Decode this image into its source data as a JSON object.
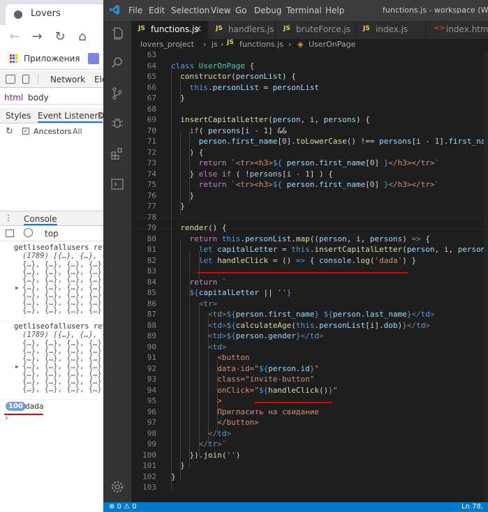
{
  "browser": {
    "tab_title": "Lovers",
    "bookmarks_label": "Приложения",
    "devtools_tabs": [
      "Network",
      "Ele"
    ],
    "breadcrumb": [
      "html",
      "body"
    ],
    "subtabs": [
      "Styles",
      "Event Listeners",
      "D"
    ],
    "ancestors_label": "Ancestors",
    "all_label": "All",
    "console_label": "Console",
    "context": "top",
    "console_log_1": {
      "title": "getliseofallusers ret",
      "summary": "(1789) [{…}, {…}, {…",
      "rows": [
        "{…}, {…}, {…}, {…}, {",
        "{…}, {…}, {…}, {…}, {",
        "{…}, {…}, {…}, {…}, {",
        "{…}, {…}, {…}, {…}, {",
        "{…}, {…}, {…}, {…}, {",
        "{…}, {…}, {…}, {…}, {",
        "{…}, {…}, {…}, {…}, {"
      ]
    },
    "console_log_2": {
      "title": "getliseofallusers ret",
      "summary": "(1789) [{…}, {…}, {…",
      "rows": [
        "{…}, {…}, {…}, {…}, {",
        "{…}, {…}, {…}, {…}, {",
        "{…}, {…}, {…}, {…}, {",
        "{…}, {…}, {…}, {…}, {",
        "{…}, {…}, {…}, {…}, {",
        "{…}, {…}, {…}, {…}, {",
        "{…}, {…}, {…}, {…}, {"
      ]
    },
    "repeat_count": "100",
    "log_message": "dada",
    "prompt": "›"
  },
  "vscode": {
    "menu": [
      "File",
      "Edit",
      "Selection",
      "View",
      "Go",
      "Debug",
      "Terminal",
      "Help"
    ],
    "window_title": "functions.js - workspace (Workspac",
    "tabs": [
      {
        "label": "functions.js",
        "kind": "JS"
      },
      {
        "label": "handlers.js",
        "kind": "JS"
      },
      {
        "label": "bruteForce.js",
        "kind": "JS"
      },
      {
        "label": "index.js",
        "kind": "JS"
      },
      {
        "label": "index.html",
        "kind": "<>"
      }
    ],
    "close_glyph": "×",
    "breadcrumb": [
      "lovers_project",
      "js",
      "functions.js",
      "UserOnPage"
    ],
    "breadcrumb_sep": "›",
    "status_left": "⊗ 0 ⚠ 0",
    "status_right": "Ln 78, C",
    "lines": [
      {
        "n": "63",
        "t": [
          [
            "",
            ""
          ]
        ]
      },
      {
        "n": "64",
        "t": [
          [
            "k",
            "class "
          ],
          [
            "c",
            "UserOnPage"
          ],
          [
            "pl",
            " {"
          ]
        ]
      },
      {
        "n": "65",
        "t": [
          [
            "pl",
            "  "
          ],
          [
            "f",
            "constructor"
          ],
          [
            "pl",
            "("
          ],
          [
            "v",
            "personList"
          ],
          [
            "pl",
            ") {"
          ]
        ]
      },
      {
        "n": "66",
        "t": [
          [
            "pl",
            "    "
          ],
          [
            "k",
            "this"
          ],
          [
            "pl",
            "."
          ],
          [
            "v",
            "personList"
          ],
          [
            "pl",
            " = "
          ],
          [
            "v",
            "personList"
          ]
        ]
      },
      {
        "n": "67",
        "t": [
          [
            "pl",
            "  }"
          ]
        ]
      },
      {
        "n": "68",
        "t": [
          [
            "",
            ""
          ]
        ]
      },
      {
        "n": "69",
        "t": [
          [
            "pl",
            "  "
          ],
          [
            "f",
            "insertCapitalLetter"
          ],
          [
            "pl",
            "("
          ],
          [
            "v",
            "person"
          ],
          [
            "pl",
            ", "
          ],
          [
            "v",
            "i"
          ],
          [
            "pl",
            ", "
          ],
          [
            "v",
            "persons"
          ],
          [
            "pl",
            ") {"
          ]
        ]
      },
      {
        "n": "70",
        "t": [
          [
            "pl",
            "    "
          ],
          [
            "kc",
            "if"
          ],
          [
            "pl",
            "( "
          ],
          [
            "v",
            "persons"
          ],
          [
            "pl",
            "["
          ],
          [
            "v",
            "i"
          ],
          [
            "pl",
            " - "
          ],
          [
            "n",
            "1"
          ],
          [
            "pl",
            "] &&"
          ]
        ]
      },
      {
        "n": "71",
        "t": [
          [
            "pl",
            "      "
          ],
          [
            "v",
            "person"
          ],
          [
            "pl",
            "."
          ],
          [
            "v",
            "first_name"
          ],
          [
            "pl",
            "["
          ],
          [
            "n",
            "0"
          ],
          [
            "pl",
            "]."
          ],
          [
            "f",
            "toLowerCase"
          ],
          [
            "pl",
            "() !== "
          ],
          [
            "v",
            "persons"
          ],
          [
            "pl",
            "["
          ],
          [
            "v",
            "i"
          ],
          [
            "pl",
            " - "
          ],
          [
            "n",
            "1"
          ],
          [
            "pl",
            "]."
          ],
          [
            "v",
            "first_name"
          ],
          [
            "pl",
            "["
          ]
        ]
      },
      {
        "n": "72",
        "t": [
          [
            "pl",
            "    ) {"
          ]
        ]
      },
      {
        "n": "73",
        "t": [
          [
            "pl",
            "      "
          ],
          [
            "kc",
            "return"
          ],
          [
            "pl",
            " "
          ],
          [
            "s",
            "`<tr><h3>"
          ],
          [
            "k",
            "${"
          ],
          [
            "pl",
            " "
          ],
          [
            "v",
            "person"
          ],
          [
            "pl",
            "."
          ],
          [
            "v",
            "first_name"
          ],
          [
            "pl",
            "["
          ],
          [
            "n",
            "0"
          ],
          [
            "pl",
            "] "
          ],
          [
            "k",
            "}"
          ],
          [
            "s",
            "</h3></tr>`"
          ]
        ]
      },
      {
        "n": "74",
        "t": [
          [
            "pl",
            "    } "
          ],
          [
            "kc",
            "else if"
          ],
          [
            "pl",
            " ( !"
          ],
          [
            "v",
            "persons"
          ],
          [
            "pl",
            "["
          ],
          [
            "v",
            "i"
          ],
          [
            "pl",
            " - "
          ],
          [
            "n",
            "1"
          ],
          [
            "pl",
            "] ) {"
          ]
        ]
      },
      {
        "n": "75",
        "t": [
          [
            "pl",
            "      "
          ],
          [
            "kc",
            "return"
          ],
          [
            "pl",
            " "
          ],
          [
            "s",
            "`<tr><h3>"
          ],
          [
            "k",
            "${"
          ],
          [
            "pl",
            " "
          ],
          [
            "v",
            "person"
          ],
          [
            "pl",
            "."
          ],
          [
            "v",
            "first_name"
          ],
          [
            "pl",
            "["
          ],
          [
            "n",
            "0"
          ],
          [
            "pl",
            "] "
          ],
          [
            "k",
            "}"
          ],
          [
            "s",
            "</h3></tr>`"
          ]
        ]
      },
      {
        "n": "76",
        "t": [
          [
            "pl",
            "    }"
          ]
        ]
      },
      {
        "n": "77",
        "t": [
          [
            "pl",
            "  }"
          ]
        ]
      },
      {
        "n": "78",
        "t": [
          [
            "",
            ""
          ]
        ]
      },
      {
        "n": "79",
        "t": [
          [
            "pl",
            "  "
          ],
          [
            "f",
            "render"
          ],
          [
            "pl",
            "() {"
          ]
        ]
      },
      {
        "n": "80",
        "t": [
          [
            "pl",
            "    "
          ],
          [
            "kc",
            "return"
          ],
          [
            "pl",
            " "
          ],
          [
            "k",
            "this"
          ],
          [
            "pl",
            "."
          ],
          [
            "v",
            "personList"
          ],
          [
            "pl",
            "."
          ],
          [
            "f",
            "map"
          ],
          [
            "pl",
            "(("
          ],
          [
            "v",
            "person"
          ],
          [
            "pl",
            ", "
          ],
          [
            "v",
            "i"
          ],
          [
            "pl",
            ", "
          ],
          [
            "v",
            "persons"
          ],
          [
            "pl",
            ") "
          ],
          [
            "k",
            "=>"
          ],
          [
            "pl",
            " {"
          ]
        ]
      },
      {
        "n": "81",
        "t": [
          [
            "pl",
            "      "
          ],
          [
            "k",
            "let"
          ],
          [
            "pl",
            " "
          ],
          [
            "v",
            "capitalLetter"
          ],
          [
            "pl",
            " = "
          ],
          [
            "k",
            "this"
          ],
          [
            "pl",
            "."
          ],
          [
            "f",
            "insertCapitalLetter"
          ],
          [
            "pl",
            "("
          ],
          [
            "v",
            "person"
          ],
          [
            "pl",
            ", "
          ],
          [
            "v",
            "i"
          ],
          [
            "pl",
            ", "
          ],
          [
            "v",
            "persons"
          ],
          [
            "pl",
            ")"
          ]
        ]
      },
      {
        "n": "82",
        "t": [
          [
            "pl",
            "      "
          ],
          [
            "k",
            "let"
          ],
          [
            "pl",
            " "
          ],
          [
            "f",
            "handleClick"
          ],
          [
            "pl",
            " = () "
          ],
          [
            "k",
            "=>"
          ],
          [
            "pl",
            " { "
          ],
          [
            "v",
            "console"
          ],
          [
            "pl",
            "."
          ],
          [
            "f",
            "log"
          ],
          [
            "pl",
            "("
          ],
          [
            "s",
            "'dada'"
          ],
          [
            "pl",
            ") }"
          ]
        ]
      },
      {
        "n": "83",
        "t": [
          [
            "",
            ""
          ]
        ]
      },
      {
        "n": "84",
        "t": [
          [
            "pl",
            "    "
          ],
          [
            "kc",
            "return"
          ],
          [
            "pl",
            " "
          ],
          [
            "s",
            "`"
          ]
        ]
      },
      {
        "n": "85",
        "t": [
          [
            "pl",
            "    "
          ],
          [
            "k",
            "${"
          ],
          [
            "v",
            "capitalLetter"
          ],
          [
            "pl",
            " || "
          ],
          [
            "s",
            "''"
          ],
          [
            "k",
            "}"
          ]
        ]
      },
      {
        "n": "86",
        "t": [
          [
            "pl",
            "      "
          ],
          [
            "tg",
            "<"
          ],
          [
            "tn",
            "tr"
          ],
          [
            "tg",
            ">"
          ]
        ]
      },
      {
        "n": "87",
        "t": [
          [
            "pl",
            "        "
          ],
          [
            "tg",
            "<"
          ],
          [
            "tn",
            "td"
          ],
          [
            "tg",
            ">"
          ],
          [
            "k",
            "${"
          ],
          [
            "v",
            "person"
          ],
          [
            "pl",
            "."
          ],
          [
            "v",
            "first_name"
          ],
          [
            "k",
            "}"
          ],
          [
            "pl",
            " "
          ],
          [
            "k",
            "${"
          ],
          [
            "v",
            "person"
          ],
          [
            "pl",
            "."
          ],
          [
            "v",
            "last_name"
          ],
          [
            "k",
            "}"
          ],
          [
            "tg",
            "</"
          ],
          [
            "tn",
            "td"
          ],
          [
            "tg",
            ">"
          ]
        ]
      },
      {
        "n": "88",
        "t": [
          [
            "pl",
            "        "
          ],
          [
            "tg",
            "<"
          ],
          [
            "tn",
            "td"
          ],
          [
            "tg",
            ">"
          ],
          [
            "k",
            "${"
          ],
          [
            "f",
            "calculateAge"
          ],
          [
            "pl",
            "("
          ],
          [
            "k",
            "this"
          ],
          [
            "pl",
            "."
          ],
          [
            "v",
            "personList"
          ],
          [
            "pl",
            "["
          ],
          [
            "v",
            "i"
          ],
          [
            "pl",
            "]."
          ],
          [
            "v",
            "dob"
          ],
          [
            "pl",
            ")"
          ],
          [
            "k",
            "}"
          ],
          [
            "tg",
            "</"
          ],
          [
            "tn",
            "td"
          ],
          [
            "tg",
            ">"
          ]
        ]
      },
      {
        "n": "89",
        "t": [
          [
            "pl",
            "        "
          ],
          [
            "tg",
            "<"
          ],
          [
            "tn",
            "td"
          ],
          [
            "tg",
            ">"
          ],
          [
            "k",
            "${"
          ],
          [
            "v",
            "person"
          ],
          [
            "pl",
            "."
          ],
          [
            "v",
            "gender"
          ],
          [
            "k",
            "}"
          ],
          [
            "tg",
            "</"
          ],
          [
            "tn",
            "td"
          ],
          [
            "tg",
            ">"
          ]
        ]
      },
      {
        "n": "90",
        "t": [
          [
            "pl",
            "        "
          ],
          [
            "tg",
            "<"
          ],
          [
            "tn",
            "td"
          ],
          [
            "tg",
            ">"
          ]
        ]
      },
      {
        "n": "91",
        "t": [
          [
            "pl",
            "          "
          ],
          [
            "s",
            "<button"
          ]
        ]
      },
      {
        "n": "92",
        "t": [
          [
            "pl",
            "          "
          ],
          [
            "s",
            "data-id=\""
          ],
          [
            "k",
            "${"
          ],
          [
            "v",
            "person"
          ],
          [
            "pl",
            "."
          ],
          [
            "v",
            "id"
          ],
          [
            "k",
            "}"
          ],
          [
            "s",
            "\""
          ]
        ]
      },
      {
        "n": "93",
        "t": [
          [
            "pl",
            "          "
          ],
          [
            "s",
            "class=\"invite-button\""
          ]
        ]
      },
      {
        "n": "94",
        "t": [
          [
            "pl",
            "          "
          ],
          [
            "s",
            "onClick=\""
          ],
          [
            "k",
            "${"
          ],
          [
            "f",
            "handleClick"
          ],
          [
            "pl",
            "()"
          ],
          [
            "k",
            "}"
          ],
          [
            "s",
            "\""
          ]
        ]
      },
      {
        "n": "95",
        "t": [
          [
            "pl",
            "          "
          ],
          [
            "s",
            ">"
          ]
        ]
      },
      {
        "n": "96",
        "t": [
          [
            "pl",
            "          "
          ],
          [
            "s",
            "Пригласить на свидание"
          ]
        ]
      },
      {
        "n": "97",
        "t": [
          [
            "pl",
            "          "
          ],
          [
            "s",
            "</button>"
          ]
        ]
      },
      {
        "n": "98",
        "t": [
          [
            "pl",
            "        "
          ],
          [
            "tg",
            "</"
          ],
          [
            "tn",
            "td"
          ],
          [
            "tg",
            ">"
          ]
        ]
      },
      {
        "n": "99",
        "t": [
          [
            "pl",
            "      "
          ],
          [
            "tg",
            "</"
          ],
          [
            "tn",
            "tr"
          ],
          [
            "tg",
            ">"
          ],
          [
            "s",
            "`"
          ]
        ]
      },
      {
        "n": "100",
        "t": [
          [
            "pl",
            "    })."
          ],
          [
            "f",
            "join"
          ],
          [
            "pl",
            "("
          ],
          [
            "s",
            "''"
          ],
          [
            "pl",
            ")"
          ]
        ]
      },
      {
        "n": "101",
        "t": [
          [
            "pl",
            "  }"
          ]
        ]
      },
      {
        "n": "102",
        "t": [
          [
            "pl",
            "}"
          ]
        ]
      },
      {
        "n": "103",
        "t": [
          [
            "",
            ""
          ]
        ]
      }
    ]
  }
}
